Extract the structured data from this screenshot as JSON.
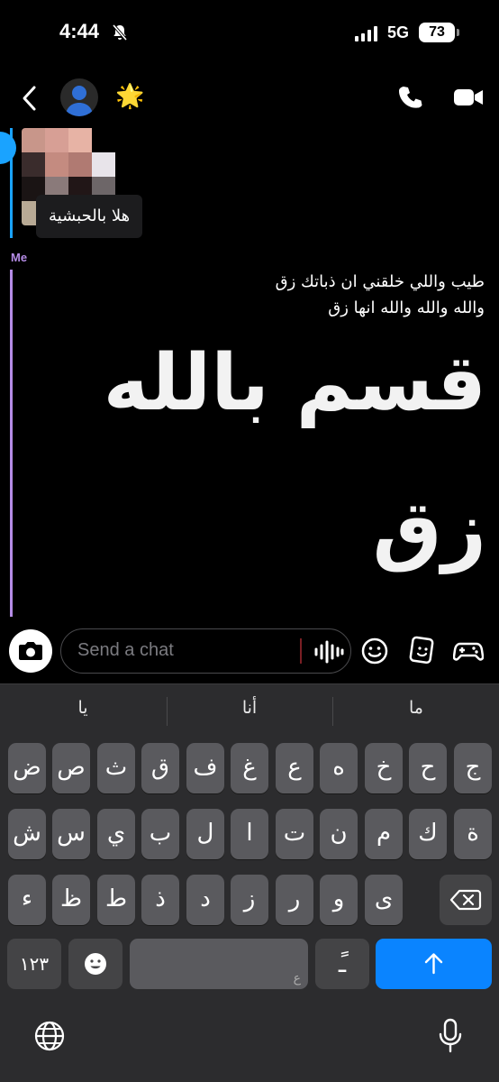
{
  "status": {
    "time": "4:44",
    "network": "5G",
    "battery": "73"
  },
  "header": {
    "contact_emoji": "🌟"
  },
  "chat": {
    "received_caption": "هلا بالحبشية",
    "me_label": "Me",
    "messages": [
      "طيب واللي خلقني ان ذباتك زق",
      "والله والله والله انها زق"
    ],
    "big_lines": [
      "قسم بالله",
      "زق"
    ]
  },
  "input": {
    "placeholder": "Send a chat"
  },
  "keyboard": {
    "suggestions": [
      "ما",
      "أنا",
      "يا"
    ],
    "row1": [
      "ج",
      "ح",
      "خ",
      "ه",
      "ع",
      "غ",
      "ف",
      "ق",
      "ث",
      "ص",
      "ض"
    ],
    "row2": [
      "ة",
      "ك",
      "م",
      "ن",
      "ت",
      "ا",
      "ل",
      "ب",
      "ي",
      "س",
      "ش"
    ],
    "row3": [
      "ى",
      "و",
      "ر",
      "ز",
      "د",
      "ذ",
      "ط",
      "ظ",
      "ء"
    ],
    "numbers_label": "١٢٣",
    "space_hint": "ع",
    "diacritic_key": "ًـ"
  },
  "colors": {
    "accent_blue": "#0a84ff",
    "me_purple": "#b58ce6",
    "friend_blue": "#1aa3ff"
  }
}
